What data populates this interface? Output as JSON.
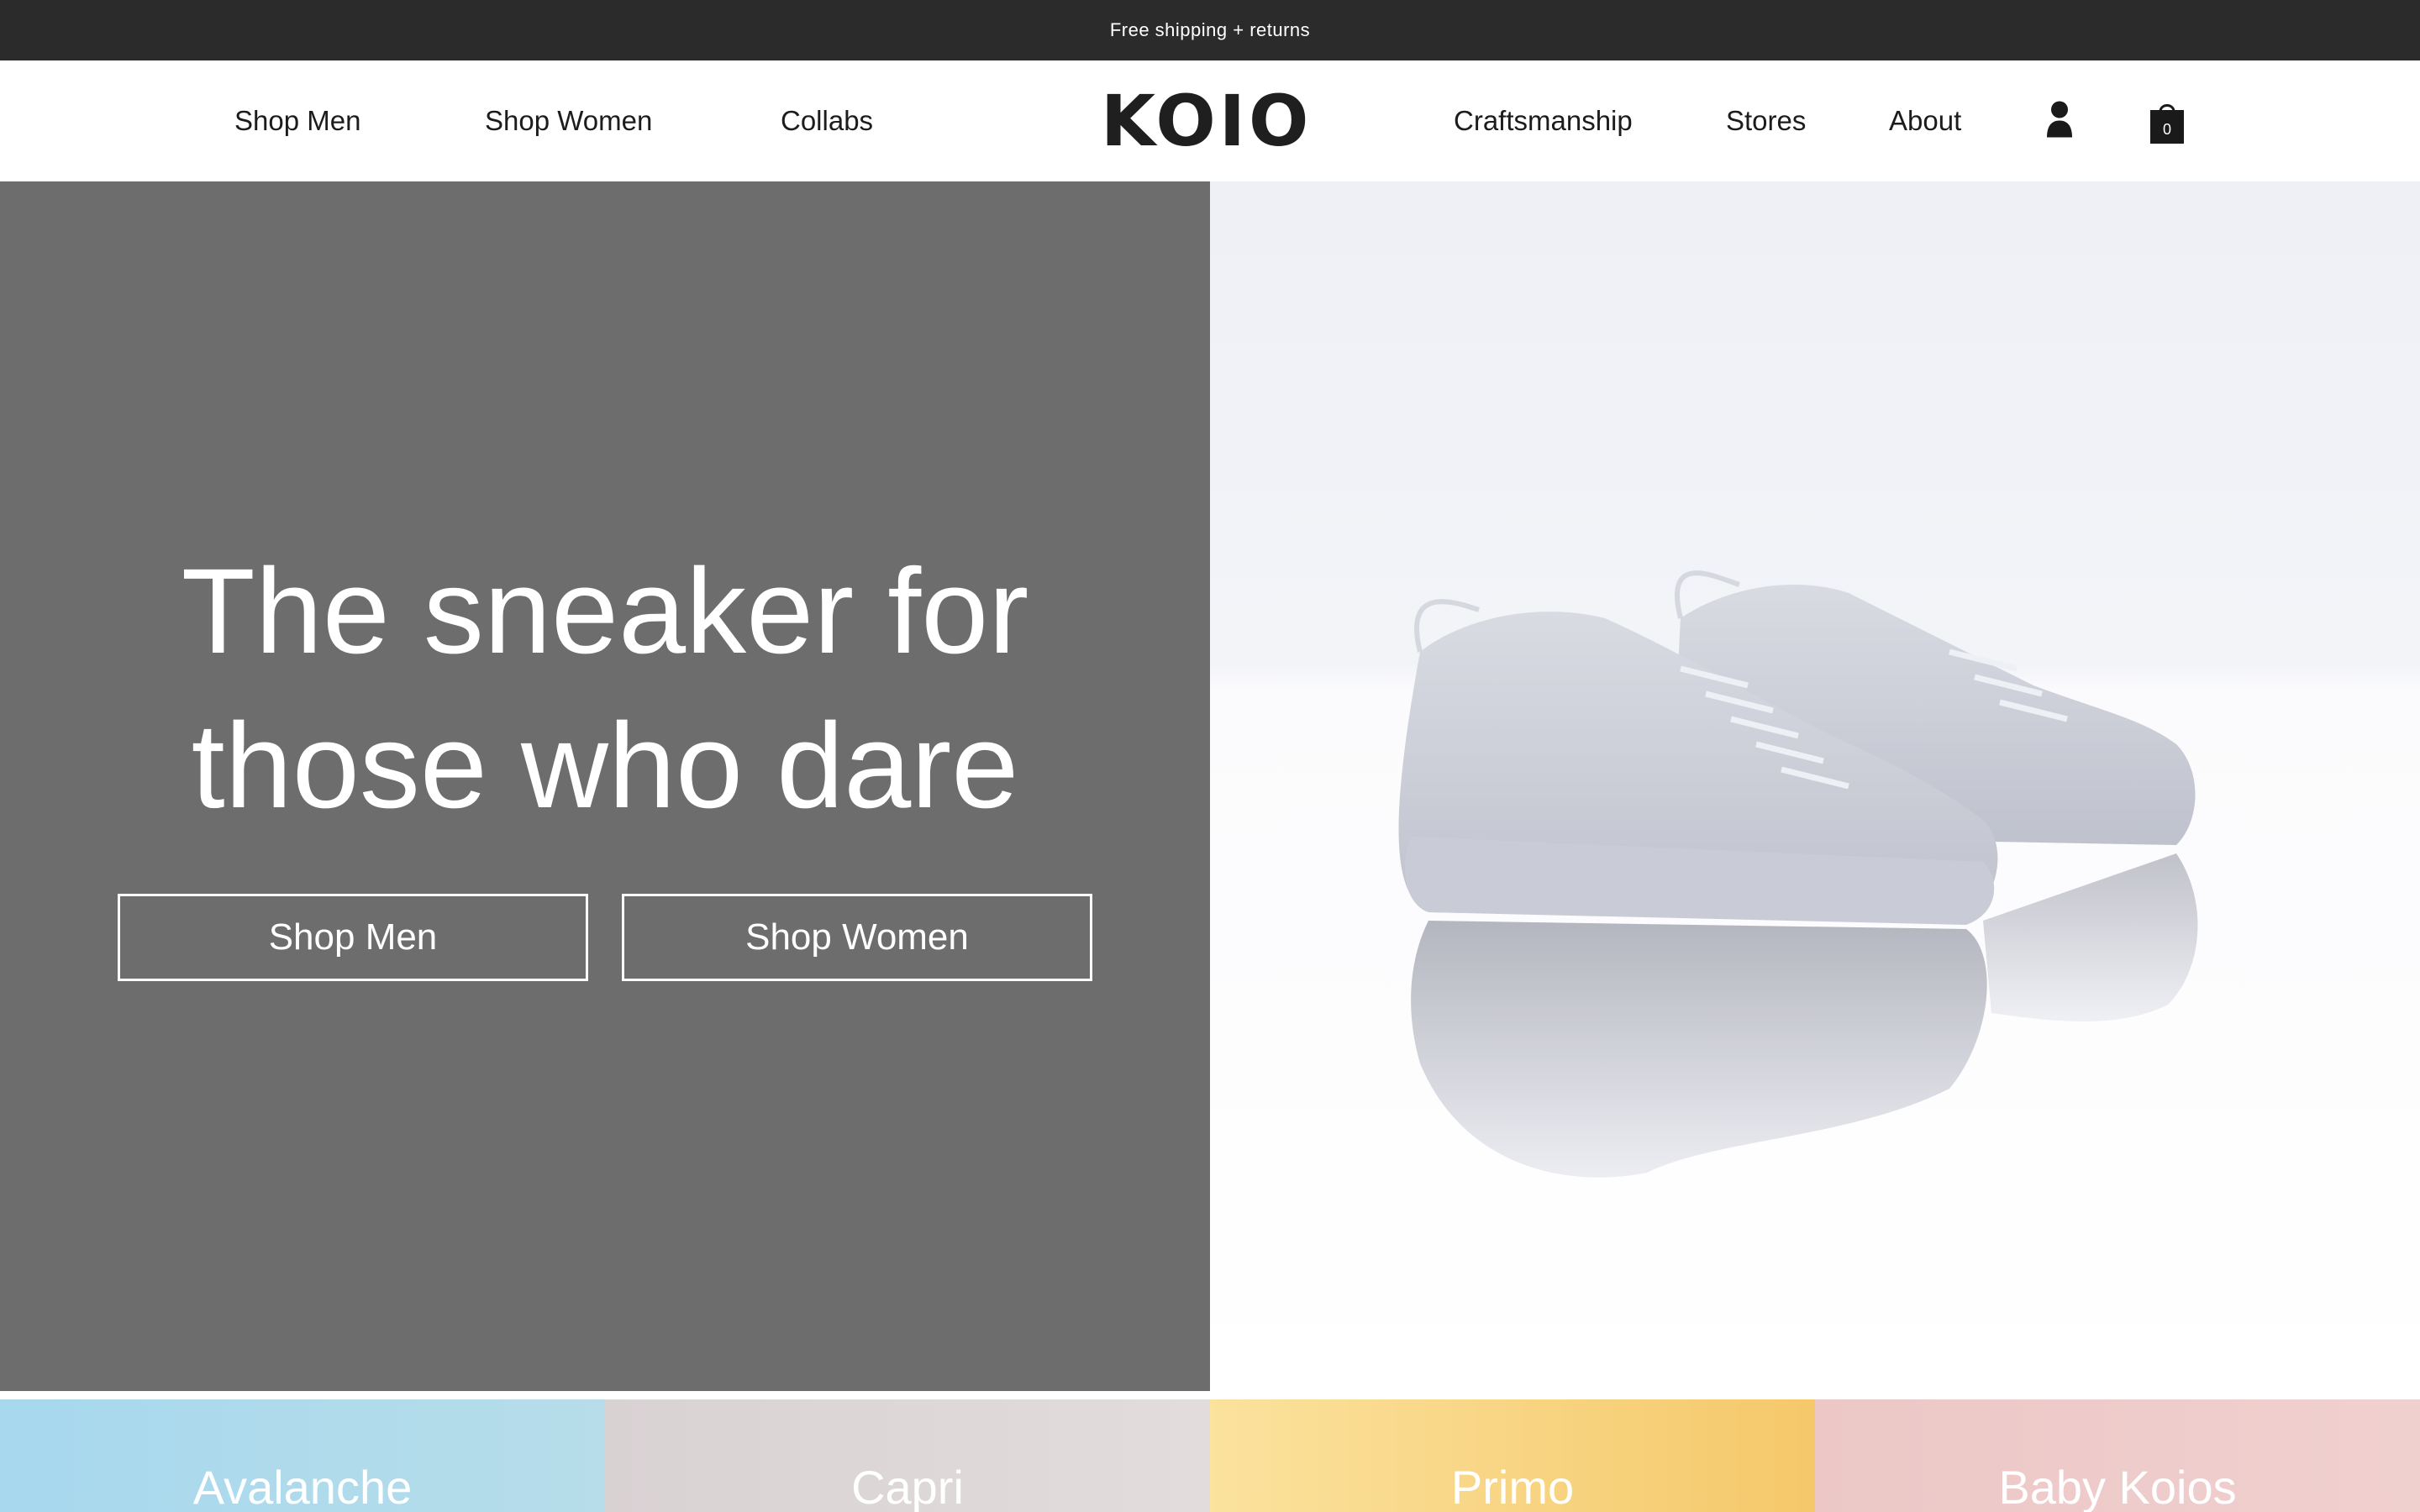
{
  "promo": {
    "text": "Free shipping + returns"
  },
  "nav": {
    "left": [
      "Shop Men",
      "Shop Women",
      "Collabs"
    ],
    "logo": "KOIO",
    "right": [
      "Craftsmanship",
      "Stores",
      "About"
    ],
    "account_icon": "user-icon",
    "cart_icon": "shopping-bag-icon",
    "cart_count": "0"
  },
  "hero": {
    "title_line1": "The sneaker for",
    "title_line2": "those who dare",
    "buttons": [
      "Shop Men",
      "Shop Women"
    ],
    "left_bg_color": "#6d6d6d",
    "image": "white-leather-sneakers"
  },
  "collections": [
    {
      "label": "Avalanche",
      "color": "#a9d8ea"
    },
    {
      "label": "Capri",
      "color": "#ddd6d6"
    },
    {
      "label": "Primo",
      "color": "#f7d27a"
    },
    {
      "label": "Baby Koios",
      "color": "#ecc8c8"
    }
  ]
}
